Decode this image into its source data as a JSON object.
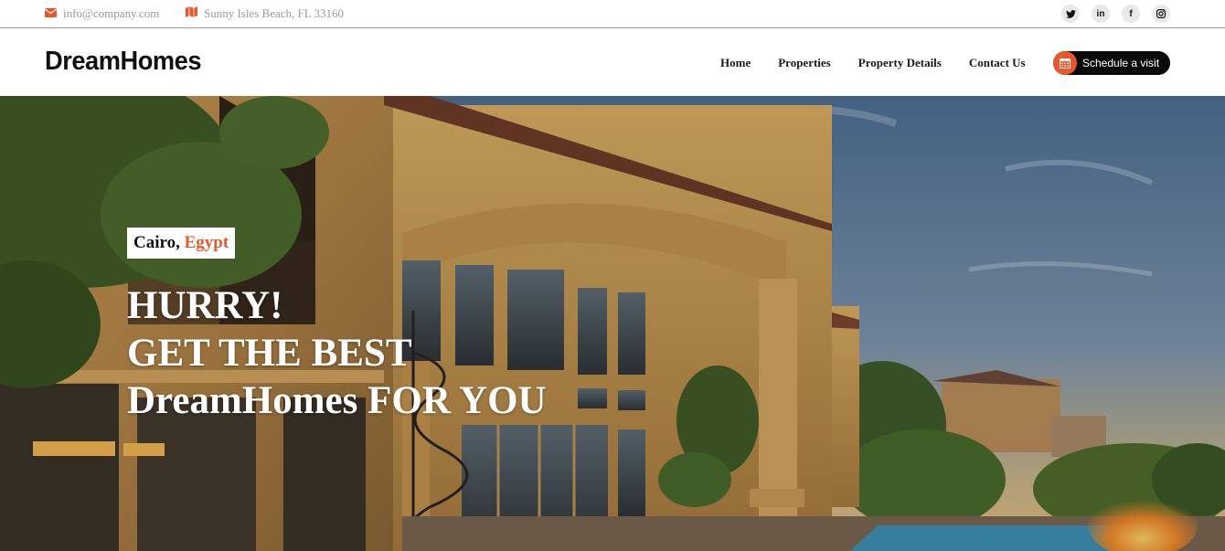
{
  "topbar": {
    "email": "info@company.com",
    "email_icon": "envelope-icon",
    "address": "Sunny Isles Beach, FL 33160",
    "address_icon": "map-icon",
    "socials": [
      {
        "name": "twitter-icon",
        "glyph": "t"
      },
      {
        "name": "linkedin-icon",
        "glyph": "in"
      },
      {
        "name": "facebook-icon",
        "glyph": "f"
      },
      {
        "name": "instagram-icon",
        "glyph": "◎"
      }
    ]
  },
  "header": {
    "logo": "DreamHomes",
    "nav": [
      "Home",
      "Properties",
      "Property Details",
      "Contact Us"
    ],
    "cta_label": "Schedule a visit",
    "cta_icon": "calendar-icon",
    "accent": "#e8582b"
  },
  "hero": {
    "city": "Cairo,",
    "country": "Egypt",
    "headline_lines": [
      "HURRY!",
      "GET THE BEST",
      "DreamHomes FOR YOU"
    ]
  }
}
